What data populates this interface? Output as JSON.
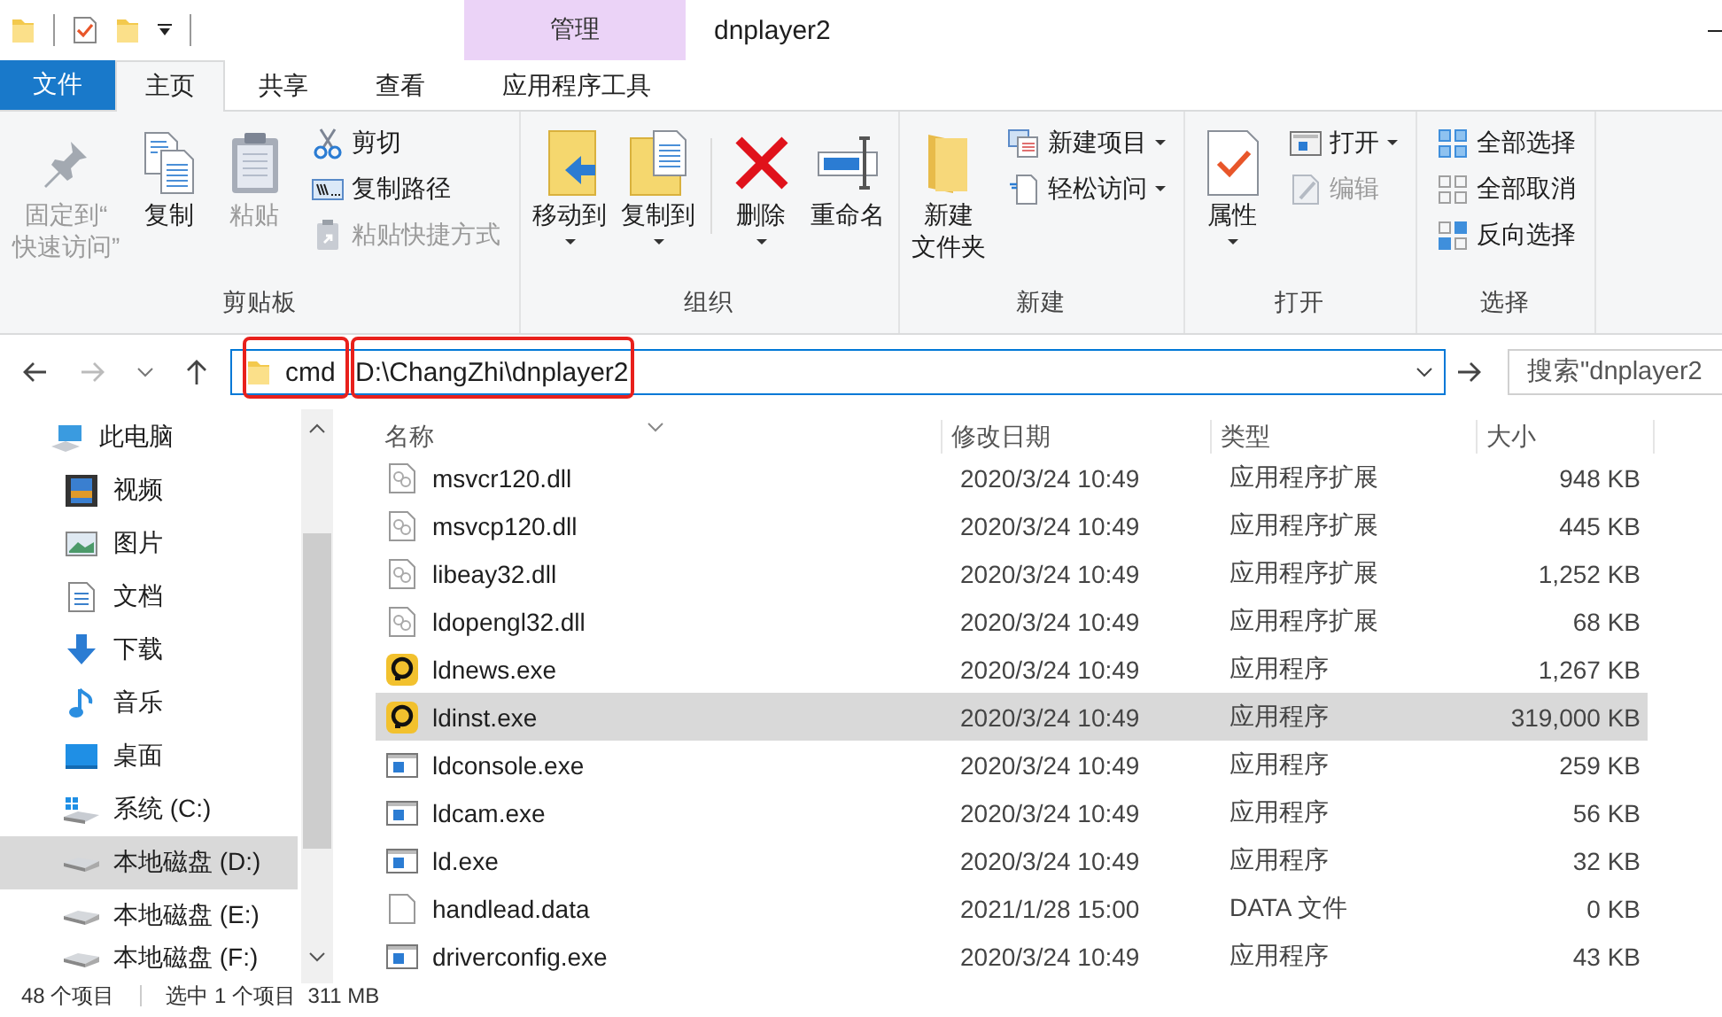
{
  "title_bar": {
    "context_tab": "管理",
    "title": "dnplayer2"
  },
  "tabs": [
    {
      "label": "文件",
      "kind": "file",
      "selected": false
    },
    {
      "label": "主页",
      "kind": "normal",
      "selected": true
    },
    {
      "label": "共享",
      "kind": "normal",
      "selected": false
    },
    {
      "label": "查看",
      "kind": "normal",
      "selected": false
    },
    {
      "label": "应用程序工具",
      "kind": "context",
      "selected": false
    }
  ],
  "ribbon": {
    "groups": [
      {
        "label": "剪贴板",
        "items": [
          {
            "label_lines": [
              "固定到“",
              "快速访问”"
            ],
            "kind": "large",
            "disabled": true,
            "dropdown": false
          },
          {
            "label": "复制",
            "kind": "large",
            "disabled": false,
            "dropdown": false
          },
          {
            "label": "粘贴",
            "kind": "large",
            "disabled": true,
            "dropdown": false
          },
          {
            "label": "剪切",
            "kind": "small",
            "disabled": false,
            "dropdown": false
          },
          {
            "label": "复制路径",
            "kind": "small",
            "disabled": false,
            "dropdown": false
          },
          {
            "label": "粘贴快捷方式",
            "kind": "small",
            "disabled": true,
            "dropdown": false
          }
        ]
      },
      {
        "label": "组织",
        "items": [
          {
            "label": "移动到",
            "kind": "large",
            "disabled": false,
            "dropdown": true
          },
          {
            "label": "复制到",
            "kind": "large",
            "disabled": false,
            "dropdown": true
          },
          {
            "kind": "separator"
          },
          {
            "label": "删除",
            "kind": "large",
            "disabled": false,
            "dropdown": true
          },
          {
            "label": "重命名",
            "kind": "large",
            "disabled": false,
            "dropdown": false
          }
        ]
      },
      {
        "label": "新建",
        "items": [
          {
            "label_lines": [
              "新建",
              "文件夹"
            ],
            "kind": "large",
            "disabled": false,
            "dropdown": false
          },
          {
            "label": "新建项目",
            "kind": "small",
            "disabled": false,
            "dropdown": true
          },
          {
            "label": "轻松访问",
            "kind": "small",
            "disabled": false,
            "dropdown": true
          }
        ]
      },
      {
        "label": "打开",
        "items": [
          {
            "label": "属性",
            "kind": "large",
            "disabled": false,
            "dropdown": true
          },
          {
            "label": "打开",
            "kind": "small",
            "disabled": false,
            "dropdown": true
          },
          {
            "label": "编辑",
            "kind": "small",
            "disabled": true,
            "dropdown": false
          }
        ]
      },
      {
        "label": "选择",
        "items": [
          {
            "label": "全部选择",
            "kind": "small",
            "disabled": false,
            "dropdown": false
          },
          {
            "label": "全部取消",
            "kind": "small",
            "disabled": false,
            "dropdown": false
          },
          {
            "label": "反向选择",
            "kind": "small",
            "disabled": false,
            "dropdown": false
          }
        ]
      }
    ]
  },
  "address_bar": {
    "path": "cmd D:\\ChangZhi\\dnplayer2"
  },
  "search": {
    "placeholder": "搜索\"dnplayer2"
  },
  "sidebar": {
    "items": [
      {
        "label": "此电脑",
        "selected": false,
        "children": [
          {
            "label": "视频",
            "selected": false
          },
          {
            "label": "图片",
            "selected": false
          },
          {
            "label": "文档",
            "selected": false
          },
          {
            "label": "下载",
            "selected": false
          },
          {
            "label": "音乐",
            "selected": false
          },
          {
            "label": "桌面",
            "selected": false
          },
          {
            "label": "系统 (C:)",
            "selected": false
          },
          {
            "label": "本地磁盘 (D:)",
            "selected": true
          },
          {
            "label": "本地磁盘 (E:)",
            "selected": false
          },
          {
            "label": "本地磁盘 (F:)",
            "selected": false
          }
        ]
      }
    ]
  },
  "file_list": {
    "columns": [
      "名称",
      "修改日期",
      "类型",
      "大小"
    ],
    "rows": [
      {
        "name": "msvcr120.dll",
        "modified": "2020/3/24 10:49",
        "type": "应用程序扩展",
        "size": "948 KB",
        "kind": "dll",
        "selected": false
      },
      {
        "name": "msvcp120.dll",
        "modified": "2020/3/24 10:49",
        "type": "应用程序扩展",
        "size": "445 KB",
        "kind": "dll",
        "selected": false
      },
      {
        "name": "libeay32.dll",
        "modified": "2020/3/24 10:49",
        "type": "应用程序扩展",
        "size": "1,252 KB",
        "kind": "dll",
        "selected": false
      },
      {
        "name": "ldopengl32.dll",
        "modified": "2020/3/24 10:49",
        "type": "应用程序扩展",
        "size": "68 KB",
        "kind": "dll",
        "selected": false
      },
      {
        "name": "ldnews.exe",
        "modified": "2020/3/24 10:49",
        "type": "应用程序",
        "size": "1,267 KB",
        "kind": "ldapp",
        "selected": false
      },
      {
        "name": "ldinst.exe",
        "modified": "2020/3/24 10:49",
        "type": "应用程序",
        "size": "319,000 KB",
        "kind": "ldapp",
        "selected": true
      },
      {
        "name": "ldconsole.exe",
        "modified": "2020/3/24 10:49",
        "type": "应用程序",
        "size": "259 KB",
        "kind": "exe",
        "selected": false
      },
      {
        "name": "ldcam.exe",
        "modified": "2020/3/24 10:49",
        "type": "应用程序",
        "size": "56 KB",
        "kind": "exe",
        "selected": false
      },
      {
        "name": "ld.exe",
        "modified": "2020/3/24 10:49",
        "type": "应用程序",
        "size": "32 KB",
        "kind": "exe",
        "selected": false
      },
      {
        "name": "handlead.data",
        "modified": "2021/1/28 15:00",
        "type": "DATA 文件",
        "size": "0 KB",
        "kind": "file",
        "selected": false
      },
      {
        "name": "driverconfig.exe",
        "modified": "2020/3/24 10:49",
        "type": "应用程序",
        "size": "43 KB",
        "kind": "exe",
        "selected": false
      }
    ]
  },
  "status_bar": {
    "item_count": "48 个项目",
    "selection": "选中 1 个项目  311 MB"
  }
}
